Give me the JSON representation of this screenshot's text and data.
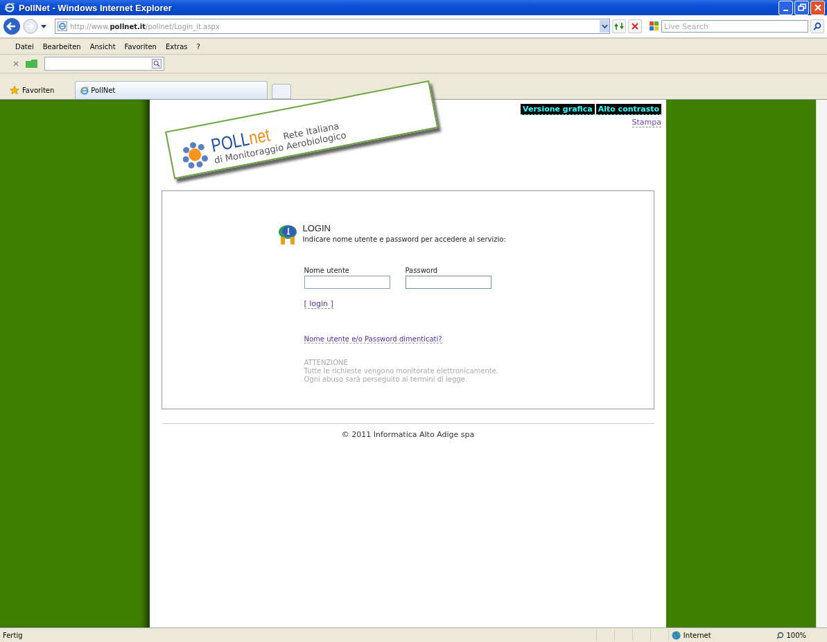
{
  "window": {
    "title": "PollNet - Windows Internet Explorer"
  },
  "address_bar": {
    "url_prefix": "http://www.",
    "url_host": "pollnet.it",
    "url_path": "/pollnet/Login_it.aspx",
    "search_placeholder": "Live Search"
  },
  "menu": [
    "Datei",
    "Bearbeiten",
    "Ansicht",
    "Favoriten",
    "Extras",
    "?"
  ],
  "favorites": {
    "label": "Favoriten"
  },
  "tabs": [
    {
      "label": "PollNet",
      "selected": true
    }
  ],
  "page": {
    "logo": {
      "brand_a": "POLL",
      "brand_b": "net",
      "line1": "Rete Italiana",
      "line2": "di Monitoraggio Aerobiologico"
    },
    "top_links": [
      "Versione grafica",
      "Alto contrasto"
    ],
    "print_link": "Stampa",
    "login": {
      "title": "LOGIN",
      "intro": "Indicare nome utente e password per accedere al servizio:",
      "fields": [
        {
          "label": "Nome utente",
          "kind": "text"
        },
        {
          "label": "Password",
          "kind": "password"
        }
      ],
      "submit": "[ login ]",
      "forgot": "Nome utente e/o Password dimenticati?",
      "notice_title": "ATTENZIONE",
      "notice_lines": [
        "Tutte le richieste vengono monitorate elettronicamente.",
        "Ogni abuso sarà perseguito ai termini di legge."
      ]
    },
    "footer": "© 2011 Informatica Alto Adige spa"
  },
  "status_bar": {
    "text": "Fertig",
    "zone": "Internet",
    "zoom": "100%"
  }
}
